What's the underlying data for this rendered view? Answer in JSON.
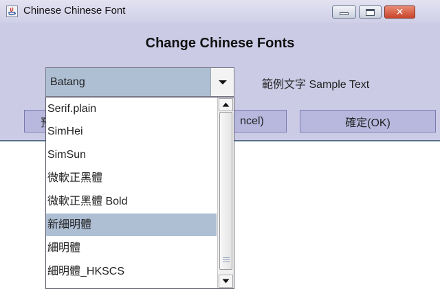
{
  "window": {
    "title": "Chinese Chinese Font",
    "app_icon": "java-icon",
    "controls": [
      "minimize-icon",
      "maximize-icon",
      "close-icon"
    ]
  },
  "dialog": {
    "heading": "Change Chinese Fonts",
    "combo": {
      "selected_value": "Batang"
    },
    "sample_text": "範例文字  Sample Text",
    "buttons": {
      "left_partial": "預",
      "cancel_partial": "ncel)",
      "ok": "確定(OK)"
    }
  },
  "dropdown": {
    "items": [
      "Serif.plain",
      "SimHei",
      "SimSun",
      "微軟正黑體",
      "微軟正黑體 Bold",
      "新細明體",
      "細明體",
      "細明體_HKSCS"
    ],
    "highlighted_index": 5
  },
  "colors": {
    "window_bg": "#cbcbe6",
    "selection": "#aebfd4",
    "button_bg": "#b8b8df"
  }
}
